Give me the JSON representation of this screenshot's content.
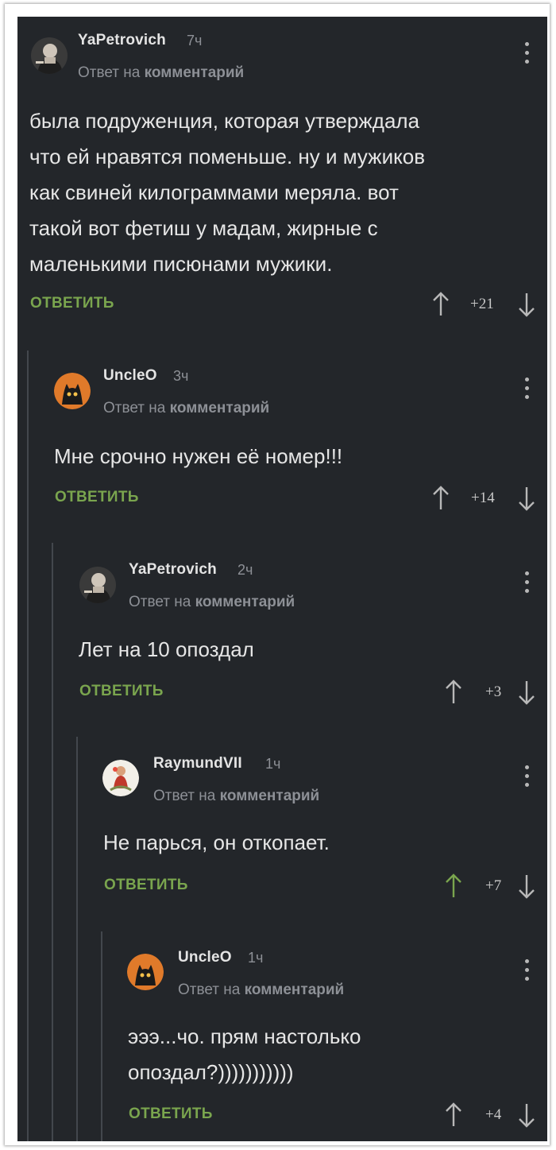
{
  "comments": [
    {
      "username": "YaPetrovich",
      "time": "7ч",
      "reply_prefix": "Ответ на",
      "reply_target": "комментарий",
      "text": "была подруженция, которая утверждала\nчто ей нравятся поменьше. ну и мужиков\nкак свиней килограммами меряла. вот\nтакой вот фетиш у мадам, жирные с\nмаленькими писюнами мужики.",
      "reply_label": "ОТВЕТИТЬ",
      "votes": "+21",
      "upvoted": false
    },
    {
      "username": "UncleO",
      "time": "3ч",
      "reply_prefix": "Ответ на",
      "reply_target": "комментарий",
      "text": "Мне срочно нужен её номер!!!",
      "reply_label": "ОТВЕТИТЬ",
      "votes": "+14",
      "upvoted": false
    },
    {
      "username": "YaPetrovich",
      "time": "2ч",
      "reply_prefix": "Ответ на",
      "reply_target": "комментарий",
      "text": "Лет на 10 опоздал",
      "reply_label": "ОТВЕТИТЬ",
      "votes": "+3",
      "upvoted": false
    },
    {
      "username": "RaymundVII",
      "time": "1ч",
      "reply_prefix": "Ответ на",
      "reply_target": "комментарий",
      "text": "Не парься, он откопает.",
      "reply_label": "ОТВЕТИТЬ",
      "votes": "+7",
      "upvoted": true
    },
    {
      "username": "UncleO",
      "time": "1ч",
      "reply_prefix": "Ответ на",
      "reply_target": "комментарий",
      "text": "эээ...чо. прям настолько\nопоздал?)))))))))))",
      "reply_label": "ОТВЕТИТЬ",
      "votes": "+4",
      "upvoted": false
    }
  ],
  "colors": {
    "background": "#23262a",
    "reply_green": "#7aa54e",
    "upvote_active": "#7aa54e",
    "thread_line": "#43474d"
  },
  "icons": {
    "upvote": "arrow-up-icon",
    "downvote": "arrow-down-icon",
    "menu": "kebab-menu-icon"
  }
}
